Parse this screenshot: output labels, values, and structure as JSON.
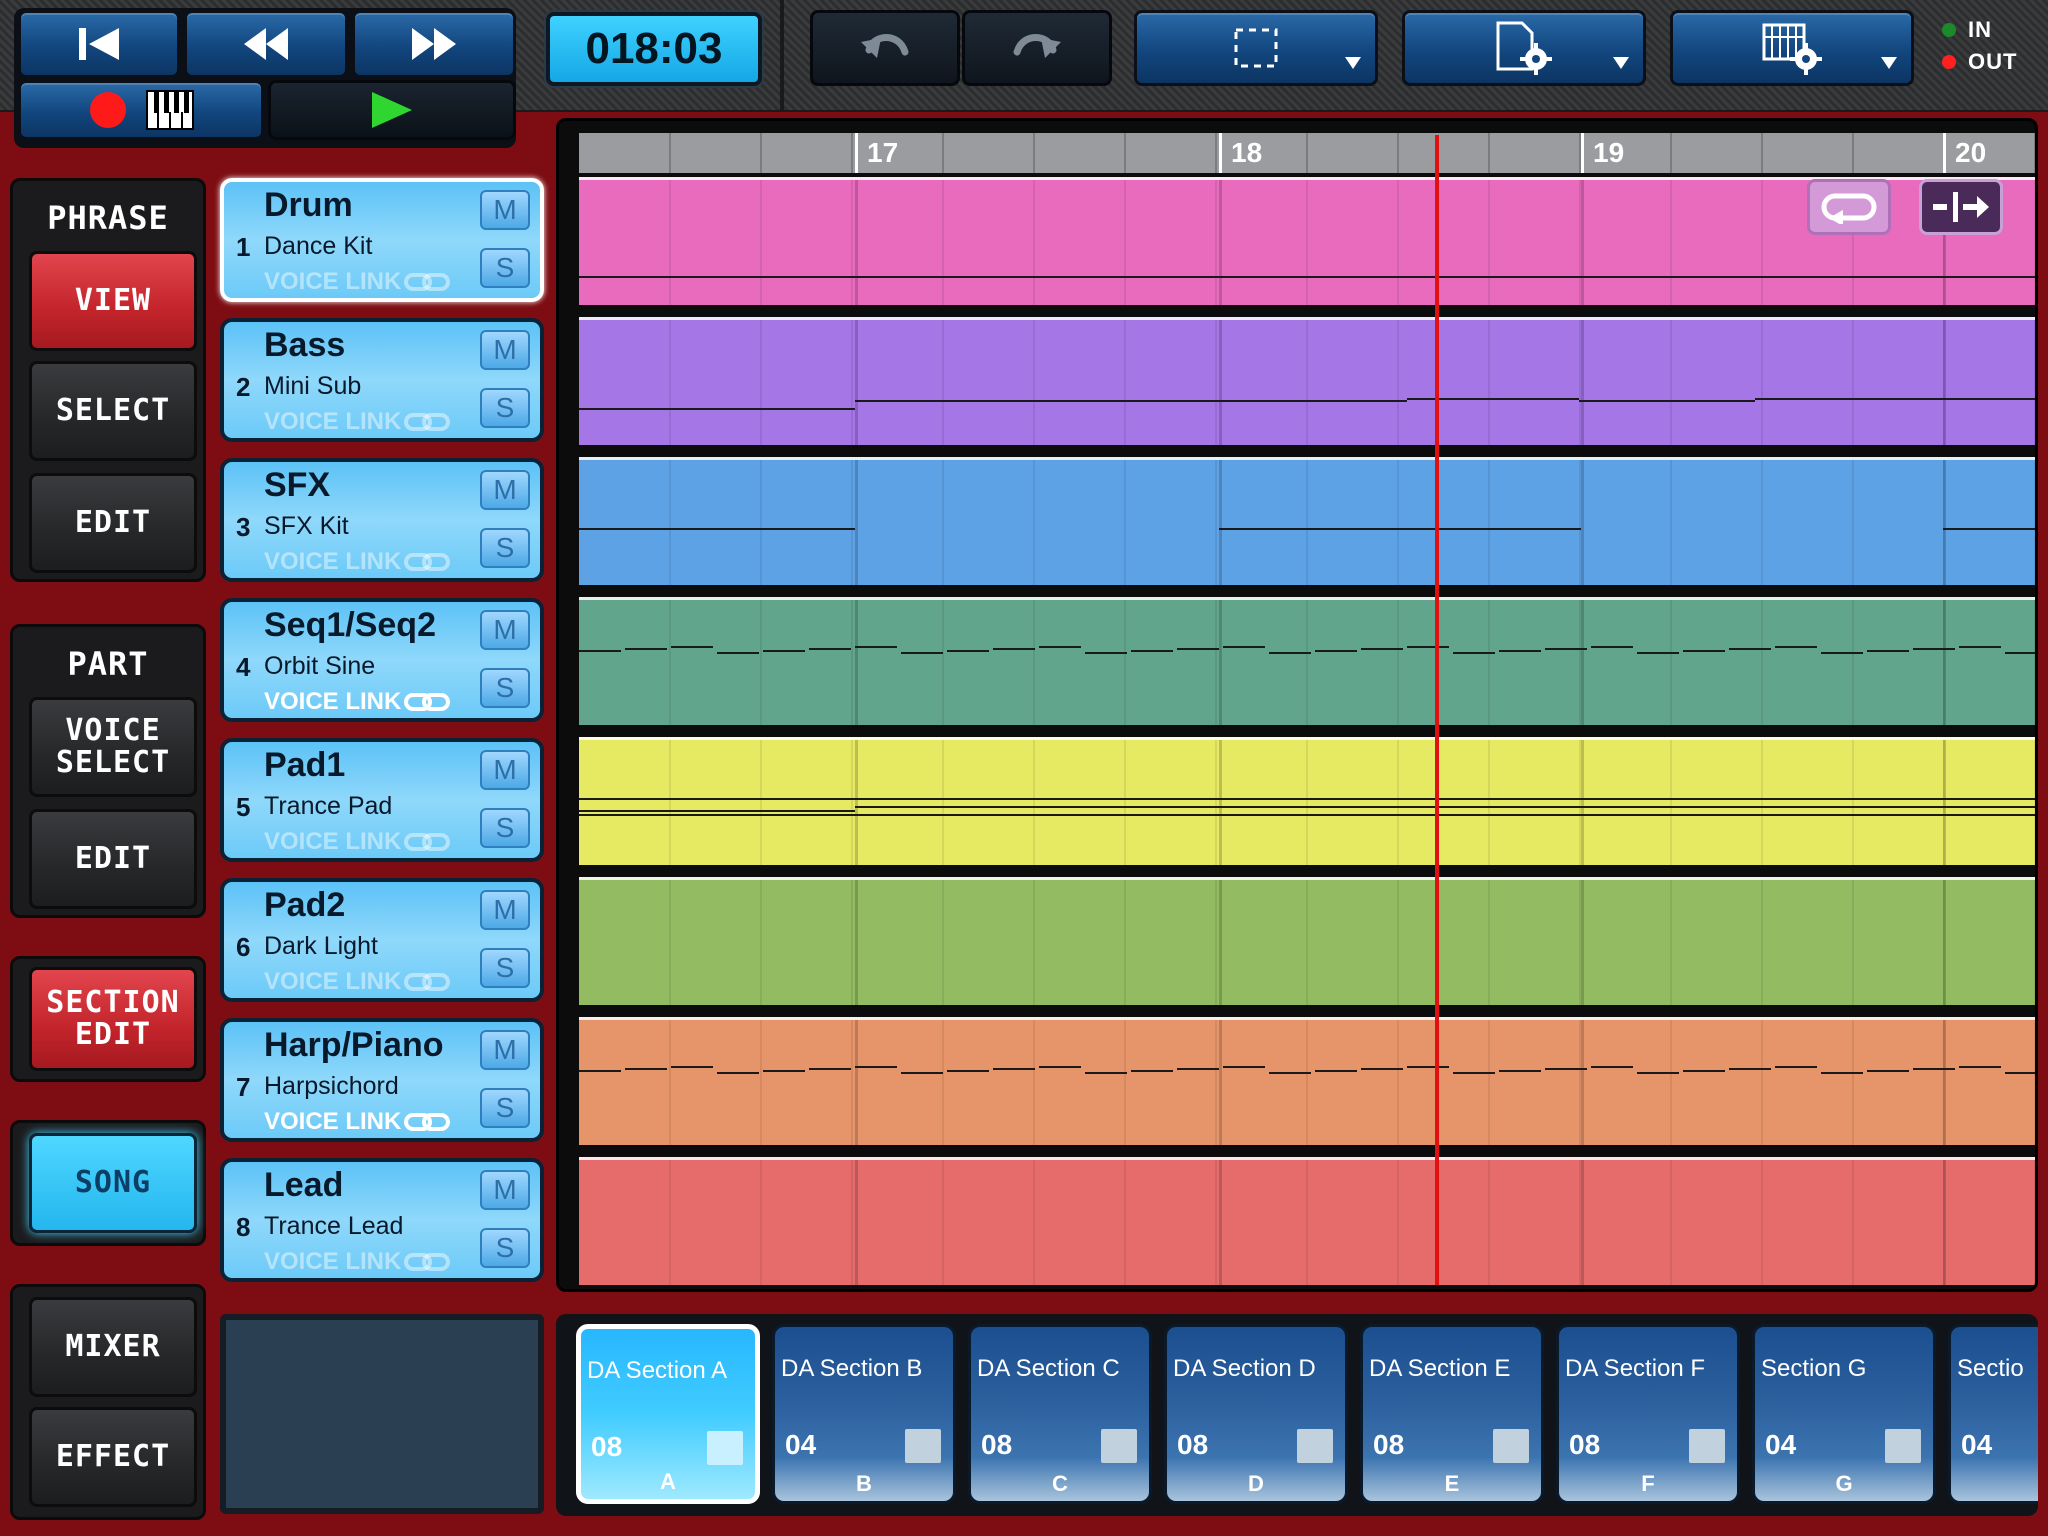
{
  "transport": {
    "time": "018:03"
  },
  "io": {
    "in_label": "IN",
    "out_label": "OUT"
  },
  "phrase": {
    "title": "PHRASE",
    "view": "VIEW",
    "select": "SELECT",
    "edit": "EDIT"
  },
  "part": {
    "title": "PART",
    "voice_select": "VOICE SELECT",
    "edit": "EDIT"
  },
  "section_edit": "SECTION EDIT",
  "song": "SONG",
  "mixer": "MIXER",
  "effect": "EFFECT",
  "voice_link_label": "VOICE LINK",
  "mute_label": "M",
  "solo_label": "S",
  "tracks": [
    {
      "num": "1",
      "name": "Drum",
      "voice": "Dance Kit",
      "voice_link_active": false,
      "color": "#e86bbd"
    },
    {
      "num": "2",
      "name": "Bass",
      "voice": "Mini Sub",
      "voice_link_active": false,
      "color": "#a476e6"
    },
    {
      "num": "3",
      "name": "SFX",
      "voice": "SFX Kit",
      "voice_link_active": false,
      "color": "#5ea2e6"
    },
    {
      "num": "4",
      "name": "Seq1/Seq2",
      "voice": "Orbit Sine",
      "voice_link_active": true,
      "color": "#62a58d"
    },
    {
      "num": "5",
      "name": "Pad1",
      "voice": "Trance Pad",
      "voice_link_active": false,
      "color": "#e6ea62"
    },
    {
      "num": "6",
      "name": "Pad2",
      "voice": "Dark Light",
      "voice_link_active": false,
      "color": "#93bc62"
    },
    {
      "num": "7",
      "name": "Harp/Piano",
      "voice": "Harpsichord",
      "voice_link_active": true,
      "color": "#e6956a"
    },
    {
      "num": "8",
      "name": "Lead",
      "voice": "Trance Lead",
      "voice_link_active": false,
      "color": "#e66c6c"
    }
  ],
  "ruler": {
    "bars": [
      "17",
      "18",
      "19",
      "20"
    ]
  },
  "sections": [
    {
      "name": "DA Section A",
      "length": "08",
      "letter": "A",
      "active": true
    },
    {
      "name": "DA Section B",
      "length": "04",
      "letter": "B",
      "active": false
    },
    {
      "name": "DA Section C",
      "length": "08",
      "letter": "C",
      "active": false
    },
    {
      "name": "DA Section D",
      "length": "08",
      "letter": "D",
      "active": false
    },
    {
      "name": "DA Section E",
      "length": "08",
      "letter": "E",
      "active": false
    },
    {
      "name": "DA Section F",
      "length": "08",
      "letter": "F",
      "active": false
    },
    {
      "name": "Section G",
      "length": "04",
      "letter": "G",
      "active": false
    },
    {
      "name": "Sectio",
      "length": "04",
      "letter": "",
      "active": false
    }
  ],
  "colors": {
    "record": "#ff1a1a",
    "play": "#2fd62f",
    "playhead": "#e11111",
    "in_led": "#1c8a2a",
    "out_led": "#ff2020"
  },
  "icons": [
    "skip-back-icon",
    "rewind-icon",
    "fast-forward-icon",
    "record-icon",
    "keyboard-icon",
    "play-icon",
    "undo-icon",
    "redo-icon",
    "selection-icon",
    "file-settings-icon",
    "grid-settings-icon",
    "loop-icon",
    "split-icon",
    "voice-link-icon"
  ]
}
